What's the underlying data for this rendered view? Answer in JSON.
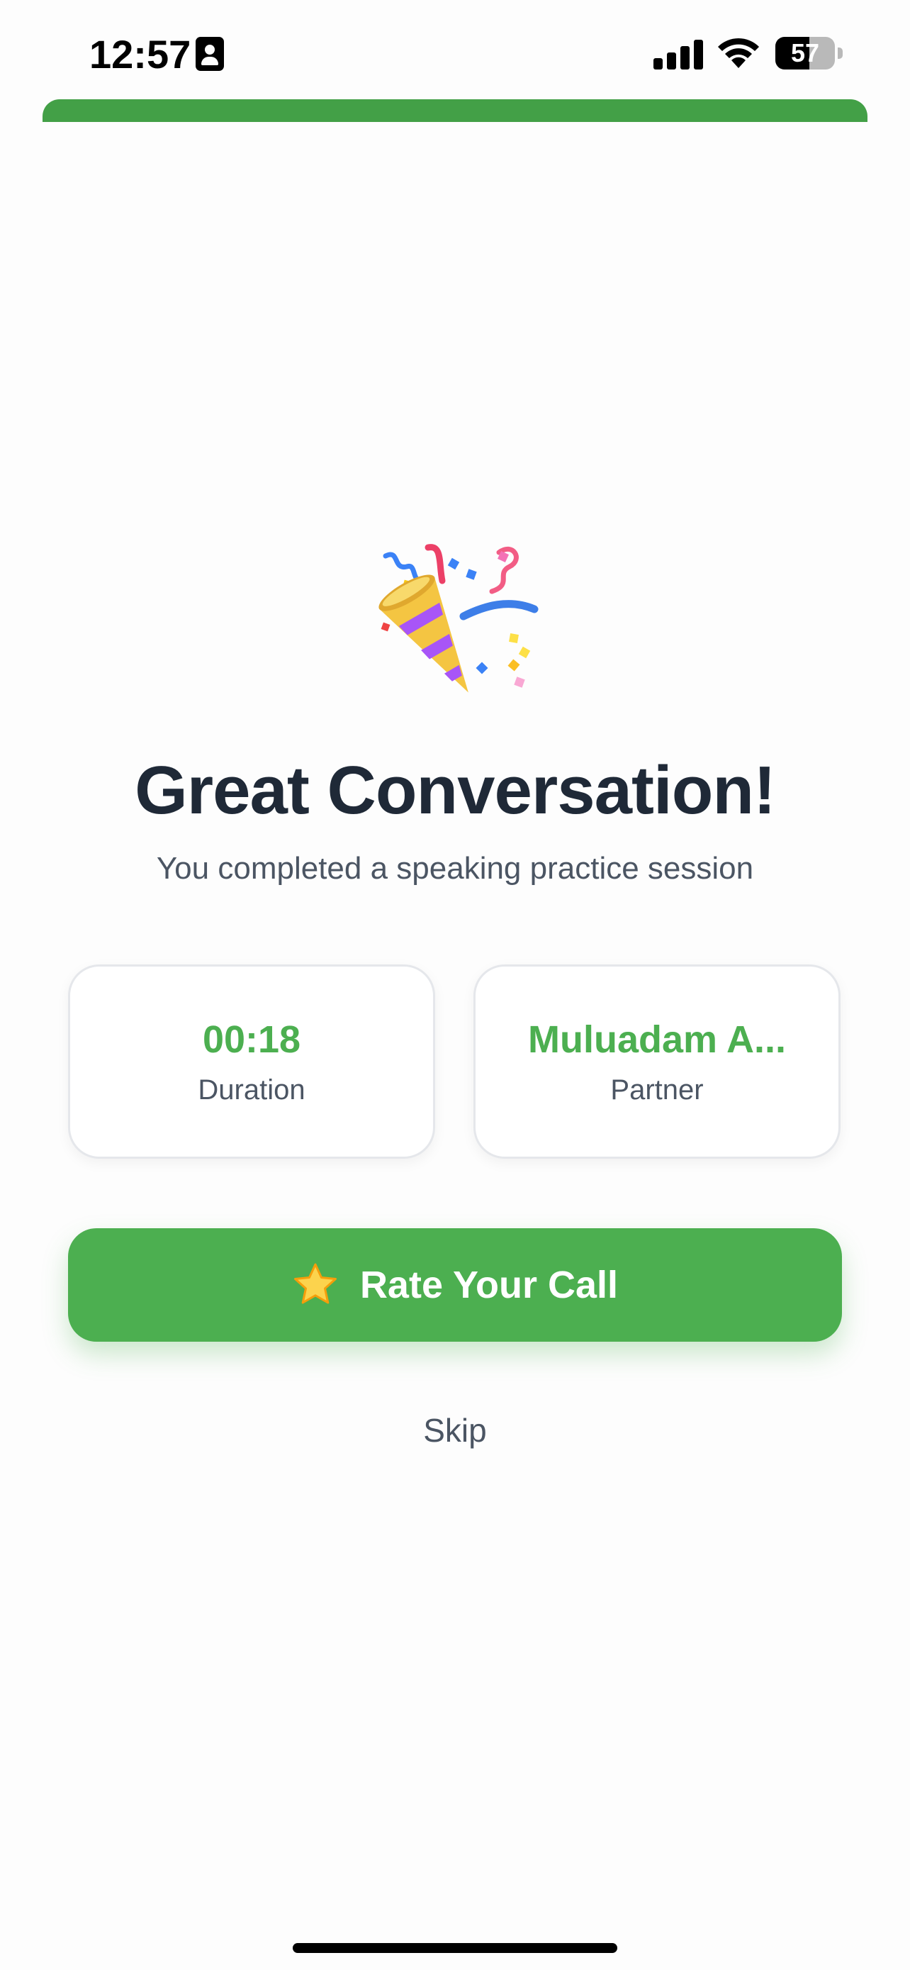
{
  "status_bar": {
    "time": "12:57",
    "battery_level": "57",
    "battery_fraction": 0.57,
    "icons": [
      "contact-card-icon",
      "cellular-signal-icon",
      "wifi-icon",
      "battery-icon"
    ]
  },
  "progress": {
    "fraction": 1.0,
    "color": "#43a047"
  },
  "celebration": {
    "icon": "party-popper-icon",
    "title": "Great Conversation!",
    "subtitle": "You completed a speaking practice session"
  },
  "stats": [
    {
      "value": "00:18",
      "label": "Duration"
    },
    {
      "value": "Muluadam A...",
      "label": "Partner"
    }
  ],
  "actions": {
    "rate_icon": "star-icon",
    "rate_label": "Rate Your Call",
    "skip_label": "Skip"
  },
  "colors": {
    "accent": "#4caf50",
    "title": "#1f2937",
    "muted": "#4b5563",
    "card_border": "#e5e7eb"
  }
}
